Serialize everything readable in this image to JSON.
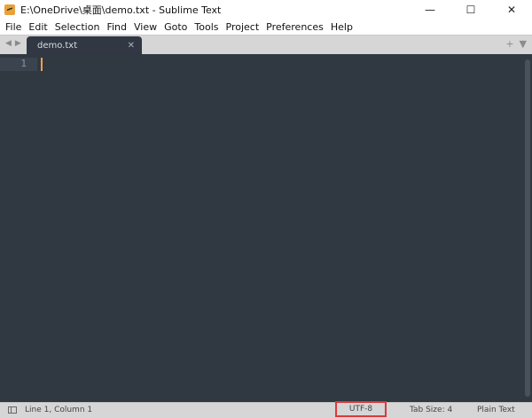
{
  "window": {
    "title": "E:\\OneDrive\\桌面\\demo.txt - Sublime Text",
    "minimize_glyph": "—",
    "maximize_glyph": "☐",
    "close_glyph": "✕"
  },
  "menu": {
    "items": [
      "File",
      "Edit",
      "Selection",
      "Find",
      "View",
      "Goto",
      "Tools",
      "Project",
      "Preferences",
      "Help"
    ]
  },
  "tabs": {
    "nav_left": "◀",
    "nav_right": "▶",
    "active_label": "demo.txt",
    "close_glyph": "✕",
    "new_tab_glyph": "+",
    "dropdown_glyph": "▼"
  },
  "editor": {
    "line_numbers": [
      "1"
    ]
  },
  "status": {
    "position": "Line 1, Column 1",
    "encoding": "UTF-8",
    "tab_size": "Tab Size: 4",
    "syntax": "Plain Text"
  },
  "colors": {
    "editor_bg": "#303841",
    "caret": "#f0a24a",
    "highlight_box": "#d93a3a"
  }
}
